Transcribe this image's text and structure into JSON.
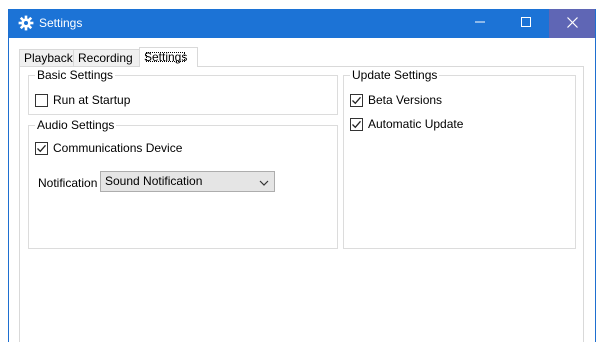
{
  "window": {
    "title": "Settings",
    "title_icon": "gear-icon",
    "titlebar_color": "#1c73d6",
    "close_hover_color": "#5f66b5"
  },
  "titlebar_buttons": {
    "minimize_icon": "minimize-icon",
    "maximize_icon": "maximize-icon",
    "close_icon": "close-icon"
  },
  "tabs": [
    {
      "label": "Playback",
      "active": false
    },
    {
      "label": "Recording",
      "active": false
    },
    {
      "label": "Settings",
      "active": true
    }
  ],
  "basic_settings": {
    "title": "Basic Settings",
    "run_at_startup": {
      "label": "Run at Startup",
      "checked": false
    }
  },
  "audio_settings": {
    "title": "Audio Settings",
    "communications_device": {
      "label": "Communications Device",
      "checked": true
    },
    "notification": {
      "label": "Notification",
      "selected": "Sound Notification"
    }
  },
  "update_settings": {
    "title": "Update Settings",
    "beta_versions": {
      "label": "Beta Versions",
      "checked": true
    },
    "automatic_update": {
      "label": "Automatic Update",
      "checked": true
    }
  }
}
